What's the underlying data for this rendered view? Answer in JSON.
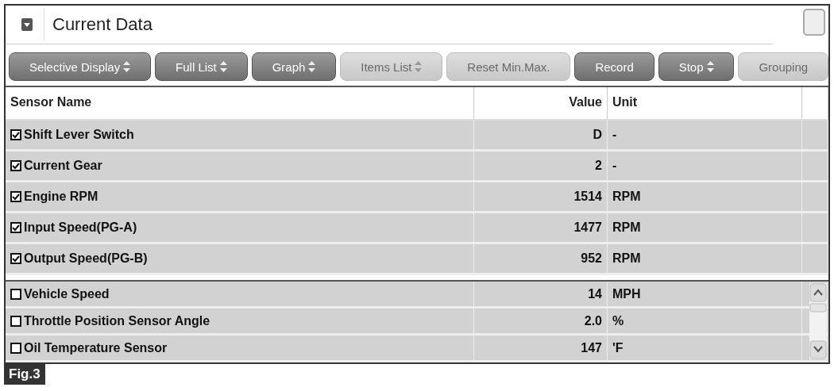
{
  "window": {
    "title": "Current Data"
  },
  "toolbar": [
    {
      "label": "Selective Display",
      "spinner": true,
      "disabled": false
    },
    {
      "label": "Full List",
      "spinner": true,
      "disabled": false
    },
    {
      "label": "Graph",
      "spinner": true,
      "disabled": false
    },
    {
      "label": "Items List",
      "spinner": true,
      "disabled": true
    },
    {
      "label": "Reset Min.Max.",
      "spinner": false,
      "disabled": true
    },
    {
      "label": "Record",
      "spinner": false,
      "disabled": false
    },
    {
      "label": "Stop",
      "spinner": true,
      "disabled": false
    },
    {
      "label": "Grouping",
      "spinner": false,
      "disabled": true
    }
  ],
  "table": {
    "columns": [
      "Sensor Name",
      "Value",
      "Unit"
    ],
    "pinned_rows": [
      {
        "name": "Shift Lever Switch",
        "value": "D",
        "unit": "-",
        "checked": true
      },
      {
        "name": "Current Gear",
        "value": "2",
        "unit": "-",
        "checked": true
      },
      {
        "name": "Engine RPM",
        "value": "1514",
        "unit": "RPM",
        "checked": true
      },
      {
        "name": "Input Speed(PG-A)",
        "value": "1477",
        "unit": "RPM",
        "checked": true
      },
      {
        "name": "Output Speed(PG-B)",
        "value": "952",
        "unit": "RPM",
        "checked": true
      }
    ],
    "rows": [
      {
        "name": "Vehicle Speed",
        "value": "14",
        "unit": "MPH",
        "checked": false
      },
      {
        "name": "Throttle Position Sensor Angle",
        "value": "2.0",
        "unit": "%",
        "checked": false
      },
      {
        "name": "Oil Temperature Sensor",
        "value": "147",
        "unit": "'F",
        "checked": false
      }
    ]
  },
  "caption": "Fig.3"
}
